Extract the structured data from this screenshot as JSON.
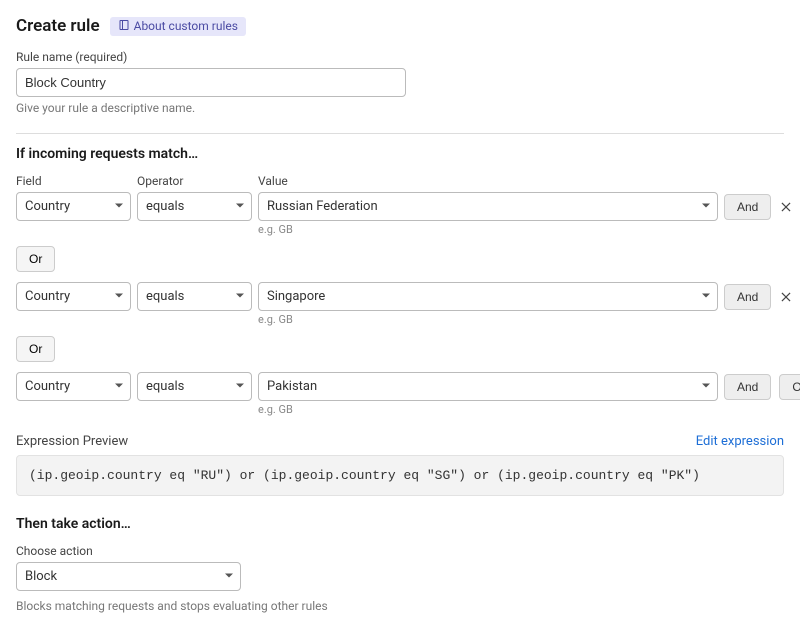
{
  "header": {
    "title": "Create rule",
    "about_link": "About custom rules"
  },
  "rule_name": {
    "label": "Rule name (required)",
    "value": "Block Country",
    "help": "Give your rule a descriptive name."
  },
  "match_section": {
    "heading": "If incoming requests match…",
    "columns": {
      "field": "Field",
      "operator": "Operator",
      "value": "Value"
    },
    "hint": "e.g. GB",
    "and_label": "And",
    "or_label": "Or"
  },
  "conditions": [
    {
      "field": "Country",
      "operator": "equals",
      "value": "Russian Federation",
      "trailing_buttons": [
        "And"
      ]
    },
    {
      "field": "Country",
      "operator": "equals",
      "value": "Singapore",
      "trailing_buttons": [
        "And"
      ]
    },
    {
      "field": "Country",
      "operator": "equals",
      "value": "Pakistan",
      "trailing_buttons": [
        "And",
        "Or"
      ]
    }
  ],
  "preview": {
    "label": "Expression Preview",
    "edit_link": "Edit expression",
    "expression": "(ip.geoip.country eq \"RU\") or (ip.geoip.country eq \"SG\") or (ip.geoip.country eq \"PK\")"
  },
  "action": {
    "heading": "Then take action…",
    "label": "Choose action",
    "value": "Block",
    "help": "Blocks matching requests and stops evaluating other rules"
  }
}
